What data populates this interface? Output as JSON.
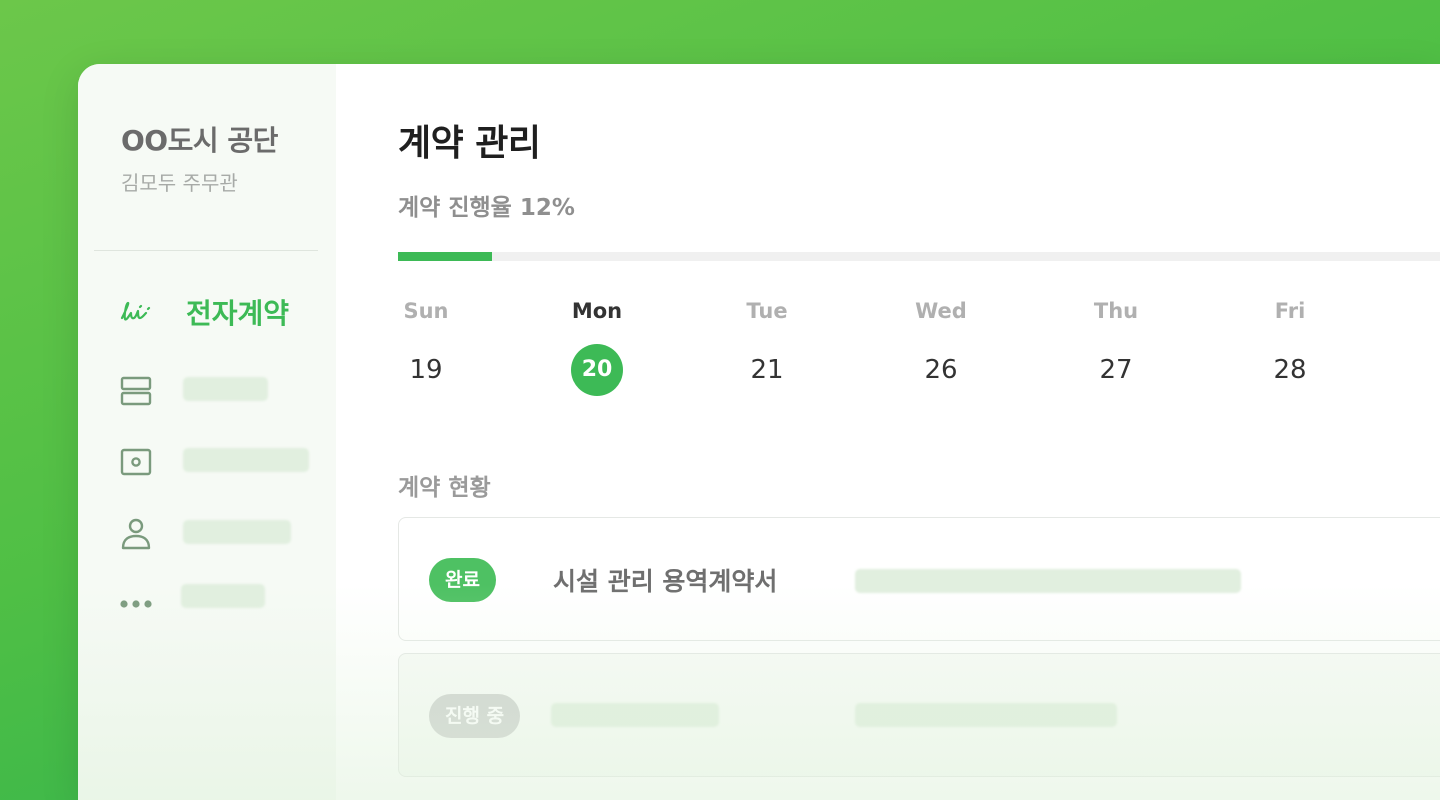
{
  "sidebar": {
    "org_name": "OO도시 공단",
    "user_name": "김모두 주무관",
    "items": [
      {
        "label": "전자계약",
        "icon": "signature-icon",
        "active": true
      },
      {
        "label": "",
        "icon": "layout-rows-icon"
      },
      {
        "label": "",
        "icon": "id-card-icon"
      },
      {
        "label": "",
        "icon": "user-icon"
      },
      {
        "label": "",
        "icon": "more-dots-icon"
      }
    ]
  },
  "main": {
    "title": "계약 관리",
    "progress": {
      "label": "계약 진행율 12%",
      "value": 12
    },
    "calendar": {
      "days": [
        {
          "name": "Sun",
          "date": "19"
        },
        {
          "name": "Mon",
          "date": "20",
          "selected": true
        },
        {
          "name": "Tue",
          "date": "21"
        },
        {
          "name": "Wed",
          "date": "26"
        },
        {
          "name": "Thu",
          "date": "27"
        },
        {
          "name": "Fri",
          "date": "28"
        }
      ]
    },
    "status_section": {
      "title": "계약 현황",
      "contracts": [
        {
          "status": "완료",
          "title": "시설 관리 용역계약서"
        },
        {
          "status": "진행 중",
          "title": ""
        }
      ]
    }
  },
  "colors": {
    "accent": "#3dba56",
    "background_gradient": [
      "#6cc74a",
      "#22ad52"
    ],
    "skeleton": "#e1efdf"
  }
}
